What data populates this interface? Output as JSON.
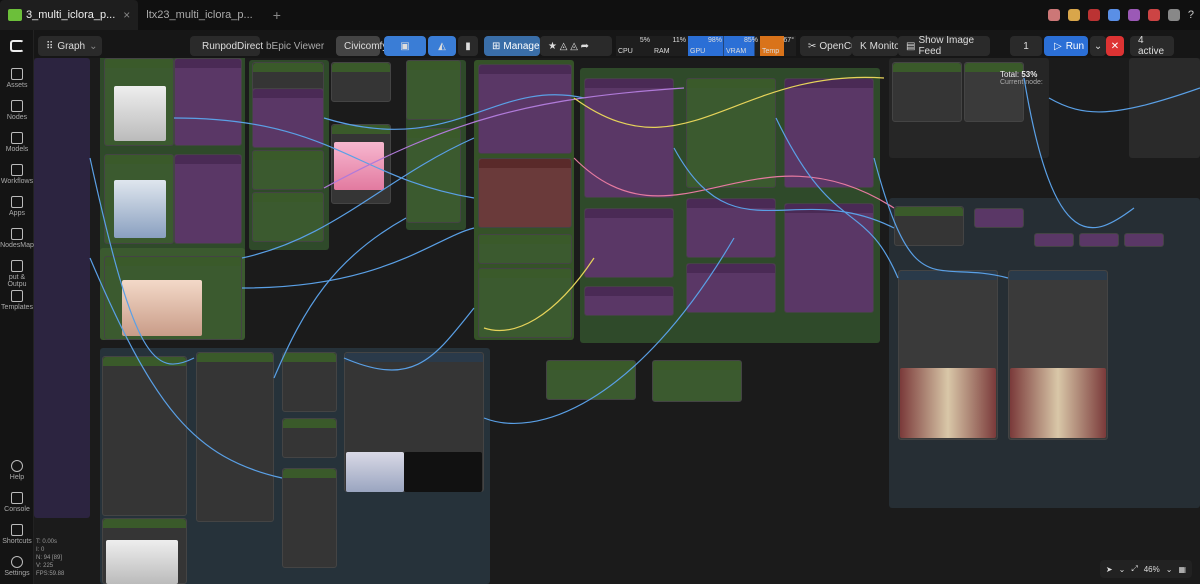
{
  "tabs": [
    {
      "label": "3_multi_iclora_p...",
      "active": true
    },
    {
      "label": "ltx23_multi_iclora_p...",
      "active": false
    }
  ],
  "sidebar": {
    "items": [
      {
        "label": "Assets"
      },
      {
        "label": "Nodes"
      },
      {
        "label": "Models"
      },
      {
        "label": "Workflows"
      },
      {
        "label": "Apps"
      },
      {
        "label": "NodesMap"
      },
      {
        "label": "put & Outpu"
      },
      {
        "label": "Templates"
      },
      {
        "label": "Help"
      },
      {
        "label": "Console"
      },
      {
        "label": "Shortcuts"
      },
      {
        "label": "Settings"
      }
    ]
  },
  "toolbar": {
    "graph_label": "Graph",
    "runpod_label": "RunpodDirect",
    "bepic_label": "bEpic Viewer",
    "civicomfy_label": "Civicomfy",
    "manager_label": "Manager",
    "opencut_label": "OpenCut",
    "monitor_label": "Monitor",
    "showimage_label": "Show Image Feed",
    "queue_count": "1",
    "run_label": "Run",
    "active_label": "4 active"
  },
  "meters": {
    "cpu": {
      "label": "CPU",
      "value": "5%"
    },
    "ram": {
      "label": "RAM",
      "value": "11%"
    },
    "gpu": {
      "label": "GPU",
      "value": "98%"
    },
    "vram": {
      "label": "VRAM",
      "value": "85%"
    },
    "temp": {
      "label": "Temp",
      "value": "67°"
    }
  },
  "progress": {
    "total_label": "Total:",
    "total_value": "53%",
    "current_label": "Current node:"
  },
  "statusbar": {
    "t": "T: 0.00s",
    "i": "I: 0",
    "n": "N: 94 [89]",
    "v": "V: 225",
    "fps": "FPS:59.88"
  },
  "zoom": {
    "value": "46%"
  },
  "colors": {
    "accent_blue": "#2b6fd6",
    "stop_red": "#d33333",
    "node_green": "#3b5a2f",
    "node_purple": "#5a3766",
    "link_blue": "#5aa0e6",
    "link_yellow": "#e6d35a"
  }
}
